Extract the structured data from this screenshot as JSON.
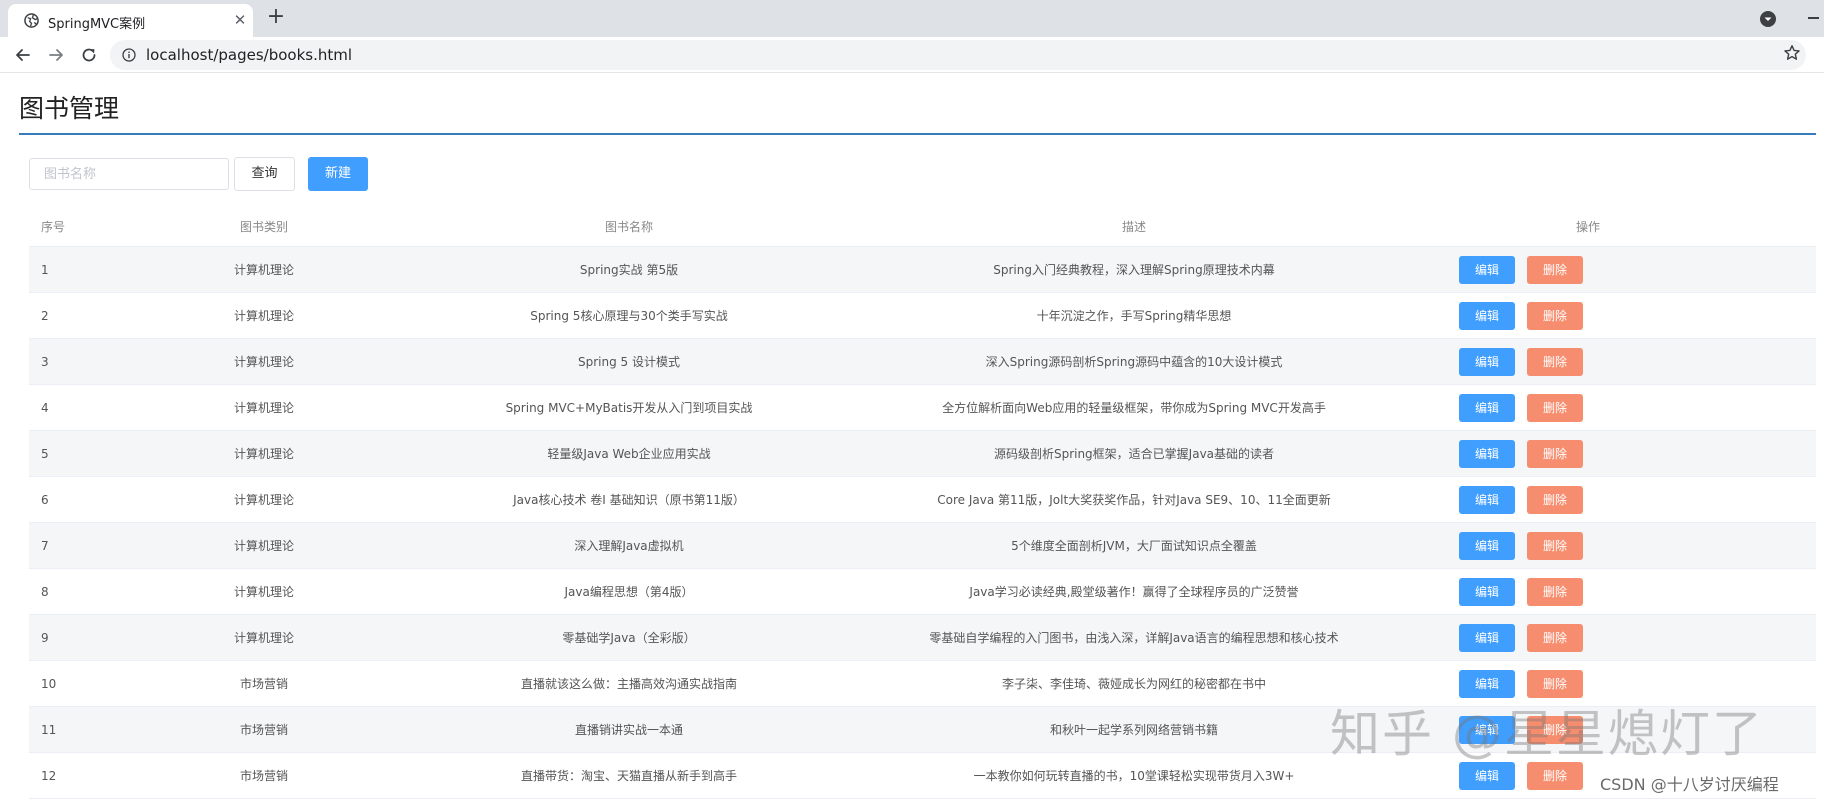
{
  "browser": {
    "tab_title": "SpringMVC案例",
    "url": "localhost/pages/books.html"
  },
  "page": {
    "title": "图书管理"
  },
  "search": {
    "placeholder": "图书名称",
    "value": "",
    "query_label": "查询",
    "new_label": "新建"
  },
  "table": {
    "headers": {
      "no": "序号",
      "category": "图书类别",
      "name": "图书名称",
      "description": "描述",
      "actions": "操作"
    },
    "edit_label": "编辑",
    "delete_label": "删除",
    "rows": [
      {
        "no": "1",
        "category": "计算机理论",
        "name": "Spring实战 第5版",
        "description": "Spring入门经典教程，深入理解Spring原理技术内幕"
      },
      {
        "no": "2",
        "category": "计算机理论",
        "name": "Spring 5核心原理与30个类手写实战",
        "description": "十年沉淀之作，手写Spring精华思想"
      },
      {
        "no": "3",
        "category": "计算机理论",
        "name": "Spring 5 设计模式",
        "description": "深入Spring源码剖析Spring源码中蕴含的10大设计模式"
      },
      {
        "no": "4",
        "category": "计算机理论",
        "name": "Spring MVC+MyBatis开发从入门到项目实战",
        "description": "全方位解析面向Web应用的轻量级框架，带你成为Spring MVC开发高手"
      },
      {
        "no": "5",
        "category": "计算机理论",
        "name": "轻量级Java Web企业应用实战",
        "description": "源码级剖析Spring框架，适合已掌握Java基础的读者"
      },
      {
        "no": "6",
        "category": "计算机理论",
        "name": "Java核心技术 卷I 基础知识（原书第11版）",
        "description": "Core Java 第11版，Jolt大奖获奖作品，针对Java SE9、10、11全面更新"
      },
      {
        "no": "7",
        "category": "计算机理论",
        "name": "深入理解Java虚拟机",
        "description": "5个维度全面剖析JVM，大厂面试知识点全覆盖"
      },
      {
        "no": "8",
        "category": "计算机理论",
        "name": "Java编程思想（第4版）",
        "description": "Java学习必读经典,殿堂级著作！赢得了全球程序员的广泛赞誉"
      },
      {
        "no": "9",
        "category": "计算机理论",
        "name": "零基础学Java（全彩版）",
        "description": "零基础自学编程的入门图书，由浅入深，详解Java语言的编程思想和核心技术"
      },
      {
        "no": "10",
        "category": "市场营销",
        "name": "直播就该这么做：主播高效沟通实战指南",
        "description": "李子柒、李佳琦、薇娅成长为网红的秘密都在书中"
      },
      {
        "no": "11",
        "category": "市场营销",
        "name": "直播销讲实战一本通",
        "description": "和秋叶一起学系列网络营销书籍"
      },
      {
        "no": "12",
        "category": "市场营销",
        "name": "直播带货：淘宝、天猫直播从新手到高手",
        "description": "一本教你如何玩转直播的书，10堂课轻松实现带货月入3W+"
      }
    ]
  },
  "watermarks": {
    "zhihu": "知乎 @星星熄灯了",
    "csdn": "CSDN @十八岁讨厌编程"
  },
  "colors": {
    "primary": "#409eff",
    "danger": "#f78d6f",
    "title_rule": "#3a7bbd",
    "stripe": "#f5f6f8"
  },
  "icons": {
    "tab_favicon": "globe-icon",
    "tab_close": "close-icon",
    "new_tab": "plus-icon",
    "back": "arrow-left-icon",
    "forward": "arrow-right-icon",
    "reload": "reload-icon",
    "site_info": "info-icon",
    "bookmark": "star-icon",
    "profile": "profile-icon"
  }
}
